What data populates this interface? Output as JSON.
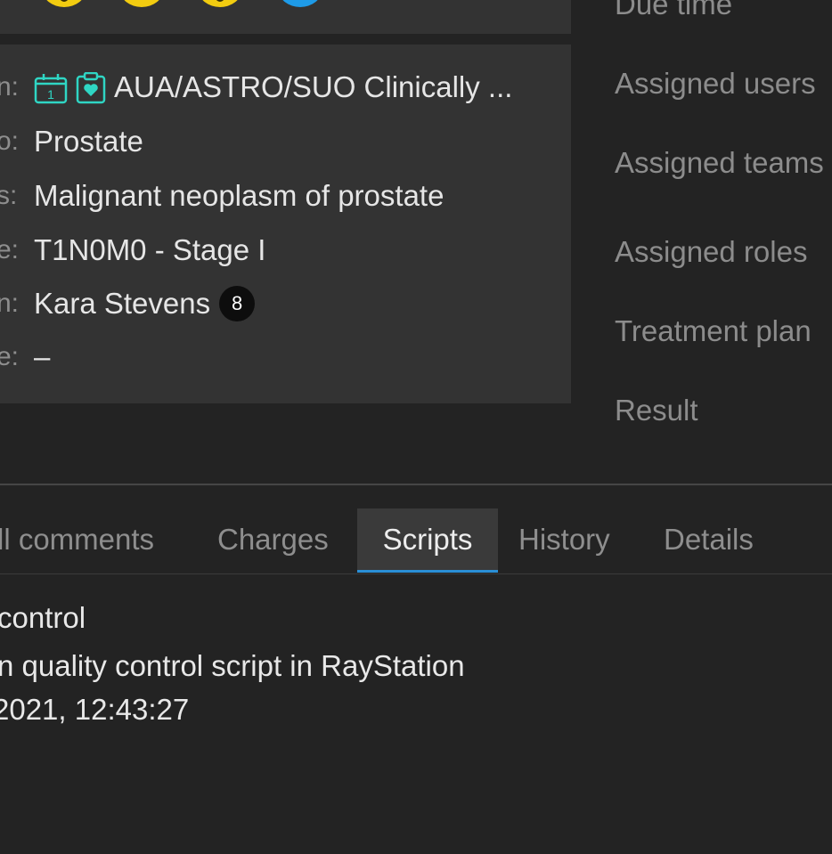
{
  "top_status": {
    "circles": [
      {
        "icon": "status-circle-icon",
        "color": "#f2cc10"
      },
      {
        "icon": "status-circle-icon",
        "color": "#f2cc10"
      },
      {
        "icon": "status-circle-icon",
        "color": "#f2cc10"
      },
      {
        "icon": "status-circle-icon",
        "color": "#1e9be8"
      }
    ]
  },
  "info": {
    "rows": [
      {
        "label": "n:",
        "value": "AUA/ASTRO/SUO Clinically ...",
        "icons": [
          "calendar-1-icon",
          "clipboard-heart-icon"
        ]
      },
      {
        "label": "o:",
        "value": "Prostate"
      },
      {
        "label": "s:",
        "value": "Malignant neoplasm of prostate"
      },
      {
        "label": "e:",
        "value": "T1N0M0 - Stage I"
      },
      {
        "label": "n:",
        "value": "Kara Stevens",
        "badge": "8"
      },
      {
        "label": "e:",
        "value": "–"
      }
    ]
  },
  "side_labels": {
    "due_time": "Due time",
    "assigned_users": "Assigned users",
    "assigned_teams": "Assigned teams",
    "assigned_roles": "Assigned roles",
    "treatment_plan": "Treatment plan",
    "result": "Result"
  },
  "tabs": [
    {
      "label": "ll comments",
      "active": false
    },
    {
      "label": "Charges",
      "active": false
    },
    {
      "label": "Scripts",
      "active": true
    },
    {
      "label": "History",
      "active": false
    },
    {
      "label": "Details",
      "active": false
    }
  ],
  "script": {
    "title": "control",
    "description": "n quality control script in RayStation",
    "timestamp": "2021, 12:43:27"
  },
  "colors": {
    "accent": "#2a8fd6",
    "icon_teal": "#2fd6c4",
    "status_yellow": "#f2cc10",
    "status_blue": "#1e9be8"
  }
}
